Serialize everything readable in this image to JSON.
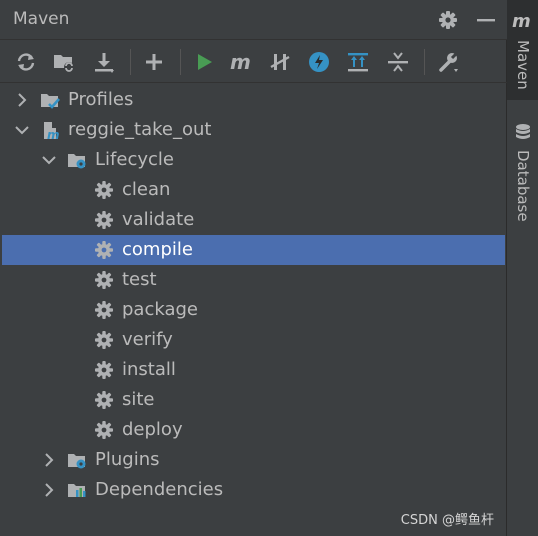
{
  "header": {
    "title": "Maven"
  },
  "toolbar": {
    "buttons": [
      "reload-icon",
      "generate-sources-icon",
      "download-icon",
      "add-icon",
      "run-icon",
      "execute-goal-icon",
      "toggle-offline-icon",
      "skip-tests-icon",
      "show-dependencies-icon",
      "collapse-all-icon",
      "settings-wrench-icon"
    ]
  },
  "tree": {
    "profiles": "Profiles",
    "project": "reggie_take_out",
    "lifecycle": "Lifecycle",
    "goals": [
      "clean",
      "validate",
      "compile",
      "test",
      "package",
      "verify",
      "install",
      "site",
      "deploy"
    ],
    "selected_goal": "compile",
    "plugins": "Plugins",
    "dependencies": "Dependencies"
  },
  "sidebar": {
    "maven_tab": "Maven",
    "database_tab": "Database"
  },
  "watermark": "CSDN @鳄鱼杆",
  "colors": {
    "panel_bg": "#3c3f41",
    "selection": "#4b6eaf",
    "run_green": "#499c54",
    "accent_blue": "#3592c4",
    "text": "#bbbbbb"
  }
}
